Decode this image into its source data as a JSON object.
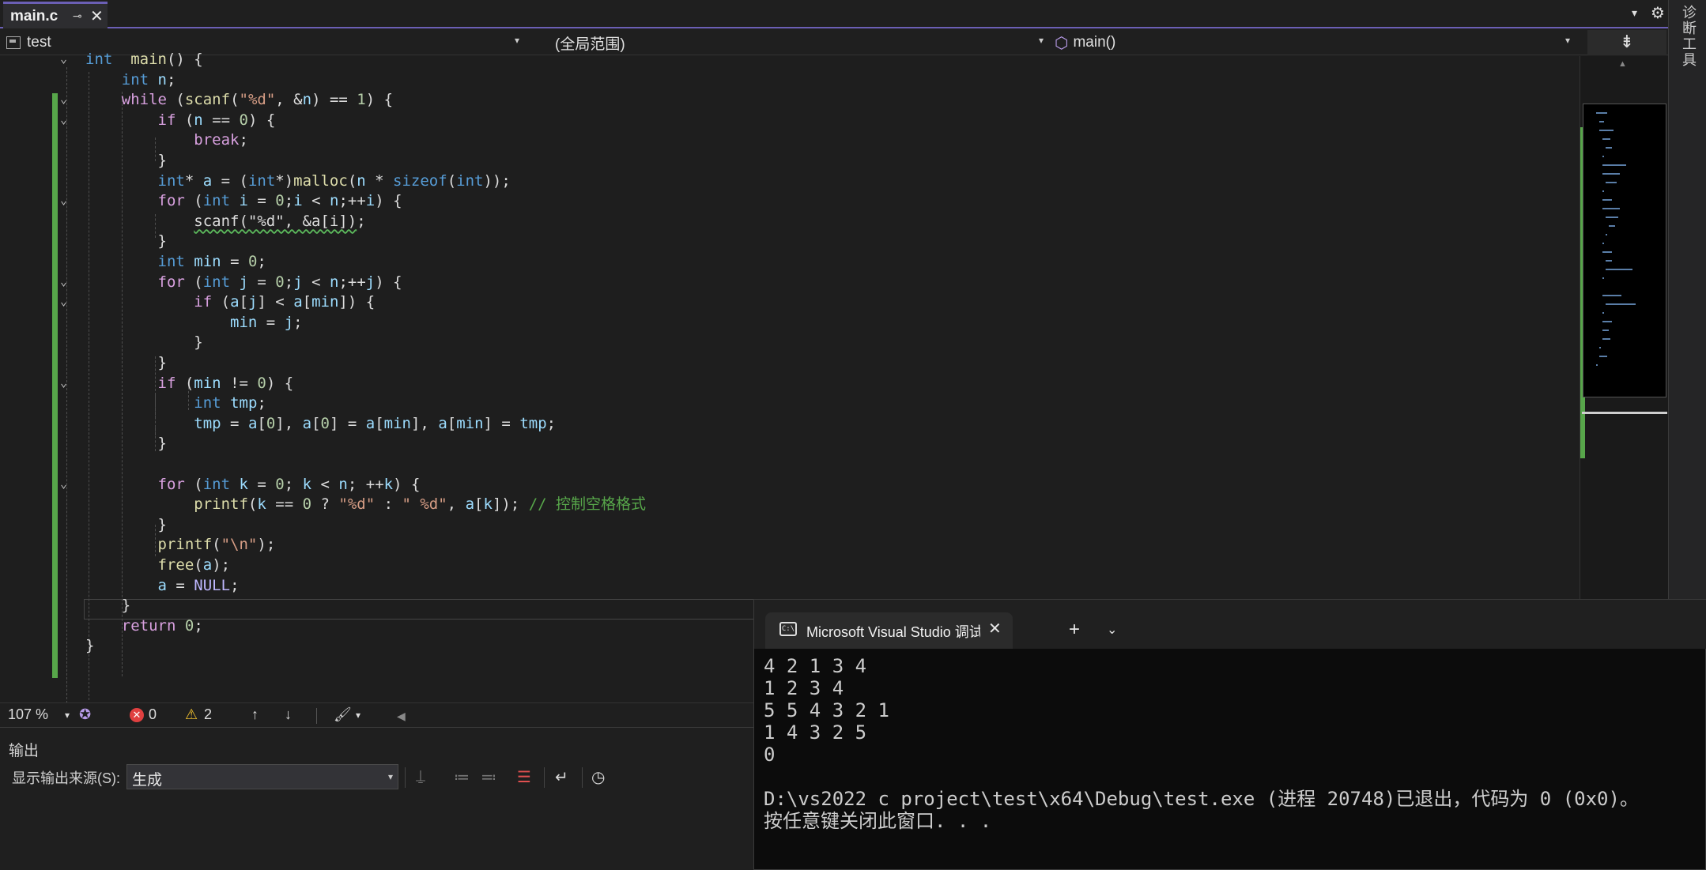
{
  "tab": {
    "title": "main.c",
    "pin_glyph": "⊸",
    "close_glyph": "✕"
  },
  "toolbar": {
    "overflow_glyph": "▾",
    "settings_glyph": "⚙"
  },
  "right_rail": {
    "label": "诊断工具"
  },
  "navbar": {
    "project": "test",
    "scope": "(全局范围)",
    "member": "main()",
    "split_glyph": "⇟"
  },
  "code": {
    "lines": [
      [
        [
          "kw",
          "int"
        ],
        [
          "",
          "  "
        ],
        [
          "fn",
          "main"
        ],
        [
          "",
          "() {"
        ]
      ],
      [
        [
          "",
          "    "
        ],
        [
          "kw",
          "int"
        ],
        [
          "",
          ""
        ],
        [
          "var",
          " n"
        ],
        [
          "",
          ";"
        ]
      ],
      [
        [
          "",
          "    "
        ],
        [
          "ctl",
          "while"
        ],
        [
          "",
          " ("
        ],
        [
          "fn",
          "scanf"
        ],
        [
          "",
          "("
        ],
        [
          "str",
          "\"%d\""
        ],
        [
          "",
          ", &"
        ],
        [
          "var",
          "n"
        ],
        [
          "",
          ") == "
        ],
        [
          "num",
          "1"
        ],
        [
          "",
          ") {"
        ]
      ],
      [
        [
          "",
          "        "
        ],
        [
          "ctl",
          "if"
        ],
        [
          "",
          " ("
        ],
        [
          "var",
          "n"
        ],
        [
          "",
          " == "
        ],
        [
          "num",
          "0"
        ],
        [
          "",
          ") {"
        ]
      ],
      [
        [
          "",
          "            "
        ],
        [
          "ctl",
          "break"
        ],
        [
          "",
          ";"
        ]
      ],
      [
        [
          "",
          "        }"
        ]
      ],
      [
        [
          "",
          "        "
        ],
        [
          "kw",
          "int"
        ],
        [
          "",
          "* "
        ],
        [
          "var",
          "a"
        ],
        [
          "",
          " = ("
        ],
        [
          "kw",
          "int"
        ],
        [
          "",
          "*)"
        ],
        [
          "fn",
          "malloc"
        ],
        [
          "",
          "("
        ],
        [
          "var",
          "n"
        ],
        [
          "",
          " * "
        ],
        [
          "kw",
          "sizeof"
        ],
        [
          "",
          "("
        ],
        [
          "kw",
          "int"
        ],
        [
          "",
          "));"
        ]
      ],
      [
        [
          "",
          "        "
        ],
        [
          "ctl",
          "for"
        ],
        [
          "",
          " ("
        ],
        [
          "kw",
          "int"
        ],
        [
          "",
          " "
        ],
        [
          "var",
          "i"
        ],
        [
          "",
          " = "
        ],
        [
          "num",
          "0"
        ],
        [
          "",
          ";"
        ],
        [
          "var",
          "i"
        ],
        [
          "",
          " < "
        ],
        [
          "var",
          "n"
        ],
        [
          "",
          ";++"
        ],
        [
          "var",
          "i"
        ],
        [
          "",
          ") {"
        ]
      ],
      [
        [
          "",
          "            "
        ],
        [
          "squig",
          "scanf(\"%d\", &a[i])"
        ],
        [
          "",
          ";"
        ]
      ],
      [
        [
          "",
          "        }"
        ]
      ],
      [
        [
          "",
          "        "
        ],
        [
          "kw",
          "int"
        ],
        [
          "",
          " "
        ],
        [
          "var",
          "min"
        ],
        [
          "",
          " = "
        ],
        [
          "num",
          "0"
        ],
        [
          "",
          ";"
        ]
      ],
      [
        [
          "",
          "        "
        ],
        [
          "ctl",
          "for"
        ],
        [
          "",
          " ("
        ],
        [
          "kw",
          "int"
        ],
        [
          "",
          " "
        ],
        [
          "var",
          "j"
        ],
        [
          "",
          " = "
        ],
        [
          "num",
          "0"
        ],
        [
          "",
          ";"
        ],
        [
          "var",
          "j"
        ],
        [
          "",
          " < "
        ],
        [
          "var",
          "n"
        ],
        [
          "",
          ";++"
        ],
        [
          "var",
          "j"
        ],
        [
          "",
          ") {"
        ]
      ],
      [
        [
          "",
          "            "
        ],
        [
          "ctl",
          "if"
        ],
        [
          "",
          " ("
        ],
        [
          "var",
          "a"
        ],
        [
          "",
          "["
        ],
        [
          "var",
          "j"
        ],
        [
          "",
          "] < "
        ],
        [
          "var",
          "a"
        ],
        [
          "",
          "["
        ],
        [
          "var",
          "min"
        ],
        [
          "",
          "]) {"
        ]
      ],
      [
        [
          "",
          "                "
        ],
        [
          "var",
          "min"
        ],
        [
          "",
          " = "
        ],
        [
          "var",
          "j"
        ],
        [
          "",
          ";"
        ]
      ],
      [
        [
          "",
          "            }"
        ]
      ],
      [
        [
          "",
          "        }"
        ]
      ],
      [
        [
          "",
          "        "
        ],
        [
          "ctl",
          "if"
        ],
        [
          "",
          " ("
        ],
        [
          "var",
          "min"
        ],
        [
          "",
          " != "
        ],
        [
          "num",
          "0"
        ],
        [
          "",
          ") {"
        ]
      ],
      [
        [
          "",
          "            "
        ],
        [
          "kw",
          "int"
        ],
        [
          "",
          " "
        ],
        [
          "var",
          "tmp"
        ],
        [
          "",
          ";"
        ]
      ],
      [
        [
          "",
          "            "
        ],
        [
          "var",
          "tmp"
        ],
        [
          "",
          " = "
        ],
        [
          "var",
          "a"
        ],
        [
          "",
          "["
        ],
        [
          "num",
          "0"
        ],
        [
          "",
          "], "
        ],
        [
          "var",
          "a"
        ],
        [
          "",
          "["
        ],
        [
          "num",
          "0"
        ],
        [
          "",
          "] = "
        ],
        [
          "var",
          "a"
        ],
        [
          "",
          "["
        ],
        [
          "var",
          "min"
        ],
        [
          "",
          "], "
        ],
        [
          "var",
          "a"
        ],
        [
          "",
          "["
        ],
        [
          "var",
          "min"
        ],
        [
          "",
          "] = "
        ],
        [
          "var",
          "tmp"
        ],
        [
          "",
          ";"
        ]
      ],
      [
        [
          "",
          "        }"
        ]
      ],
      [
        [
          "",
          ""
        ]
      ],
      [
        [
          "",
          "        "
        ],
        [
          "ctl",
          "for"
        ],
        [
          "",
          " ("
        ],
        [
          "kw",
          "int"
        ],
        [
          "",
          " "
        ],
        [
          "var",
          "k"
        ],
        [
          "",
          " = "
        ],
        [
          "num",
          "0"
        ],
        [
          "",
          "; "
        ],
        [
          "var",
          "k"
        ],
        [
          "",
          " < "
        ],
        [
          "var",
          "n"
        ],
        [
          "",
          "; ++"
        ],
        [
          "var",
          "k"
        ],
        [
          "",
          ") {"
        ]
      ],
      [
        [
          "",
          "            "
        ],
        [
          "fn",
          "printf"
        ],
        [
          "",
          "("
        ],
        [
          "var",
          "k"
        ],
        [
          "",
          " == "
        ],
        [
          "num",
          "0"
        ],
        [
          "",
          " ? "
        ],
        [
          "str",
          "\"%d\""
        ],
        [
          "",
          " : "
        ],
        [
          "str",
          "\" %d\""
        ],
        [
          "",
          ", "
        ],
        [
          "var",
          "a"
        ],
        [
          "",
          "["
        ],
        [
          "var",
          "k"
        ],
        [
          "",
          "]); "
        ],
        [
          "cmt",
          "// 控制空格格式"
        ]
      ],
      [
        [
          "",
          "        }"
        ]
      ],
      [
        [
          "",
          "        "
        ],
        [
          "fn",
          "printf"
        ],
        [
          "",
          "("
        ],
        [
          "str",
          "\"\\n\""
        ],
        [
          "",
          ");"
        ]
      ],
      [
        [
          "",
          "        "
        ],
        [
          "fn",
          "free"
        ],
        [
          "",
          "("
        ],
        [
          "var",
          "a"
        ],
        [
          "",
          ");"
        ]
      ],
      [
        [
          "",
          "        "
        ],
        [
          "var",
          "a"
        ],
        [
          "",
          " = "
        ],
        [
          "mac",
          "NULL"
        ],
        [
          "",
          ";"
        ]
      ],
      [
        [
          "",
          "    }"
        ]
      ],
      [
        [
          "",
          "    "
        ],
        [
          "ctl",
          "return"
        ],
        [
          "",
          " "
        ],
        [
          "num",
          "0"
        ],
        [
          "",
          ";"
        ]
      ],
      [
        [
          "",
          "}"
        ]
      ]
    ]
  },
  "status": {
    "zoom": "107 %",
    "errors": "0",
    "warnings": "2",
    "up_glyph": "↑",
    "down_glyph": "↓",
    "brush_glyph": "🖌",
    "caret_glyph": "▾",
    "left_glyph": "◀"
  },
  "output": {
    "title": "输出",
    "source_label": "显示输出来源(S):",
    "source_value": "生成"
  },
  "console": {
    "title": "Microsoft Visual Studio 调试控制台",
    "icon_text": "C:\\",
    "close_glyph": "✕",
    "new_glyph": "+",
    "chevron_glyph": "⌄",
    "lines": [
      "4 2 1 3 4",
      "1 2 3 4",
      "5 5 4 3 2 1",
      "1 4 3 2 5",
      "0",
      "",
      "D:\\vs2022 c project\\test\\x64\\Debug\\test.exe (进程 20748)已退出，代码为 0 (0x0)。",
      "按任意键关闭此窗口. . ."
    ]
  },
  "colors": {
    "accent": "#6b5fb5",
    "change_bar": "#57a64a",
    "error": "#e04040",
    "warning": "#f2c12e"
  }
}
